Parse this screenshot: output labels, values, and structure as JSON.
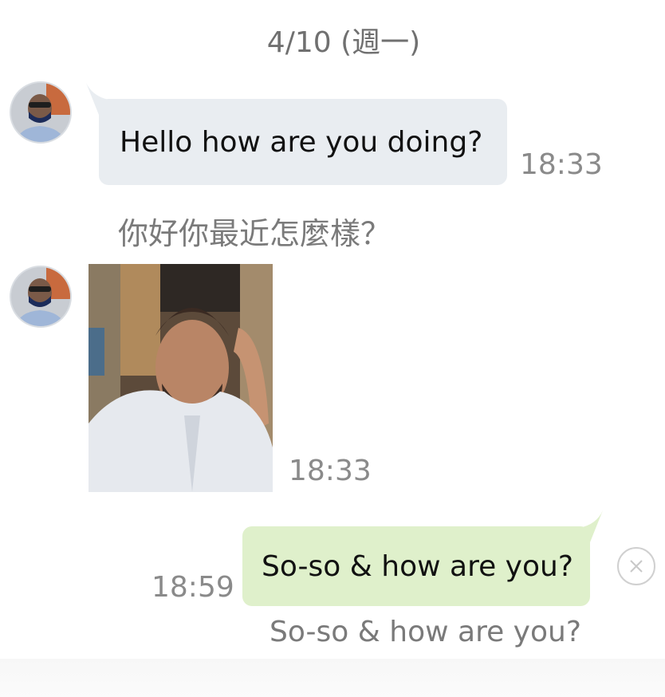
{
  "date_separator": "4/10 (週一)",
  "messages": [
    {
      "direction": "incoming",
      "type": "text",
      "text": "Hello how are you doing?",
      "time": "18:33",
      "translation": "你好你最近怎麼樣？"
    },
    {
      "direction": "incoming",
      "type": "photo",
      "time": "18:33"
    },
    {
      "direction": "outgoing",
      "type": "text",
      "text": "So-so & how are you?",
      "time": "18:59",
      "translation": "So-so & how are you?",
      "status_icon": "close-icon"
    }
  ],
  "colors": {
    "incoming_bubble": "#e9edf1",
    "outgoing_bubble": "#dff0cb",
    "timestamp": "#8a8a8a",
    "translation_text": "#7a7a7a"
  }
}
